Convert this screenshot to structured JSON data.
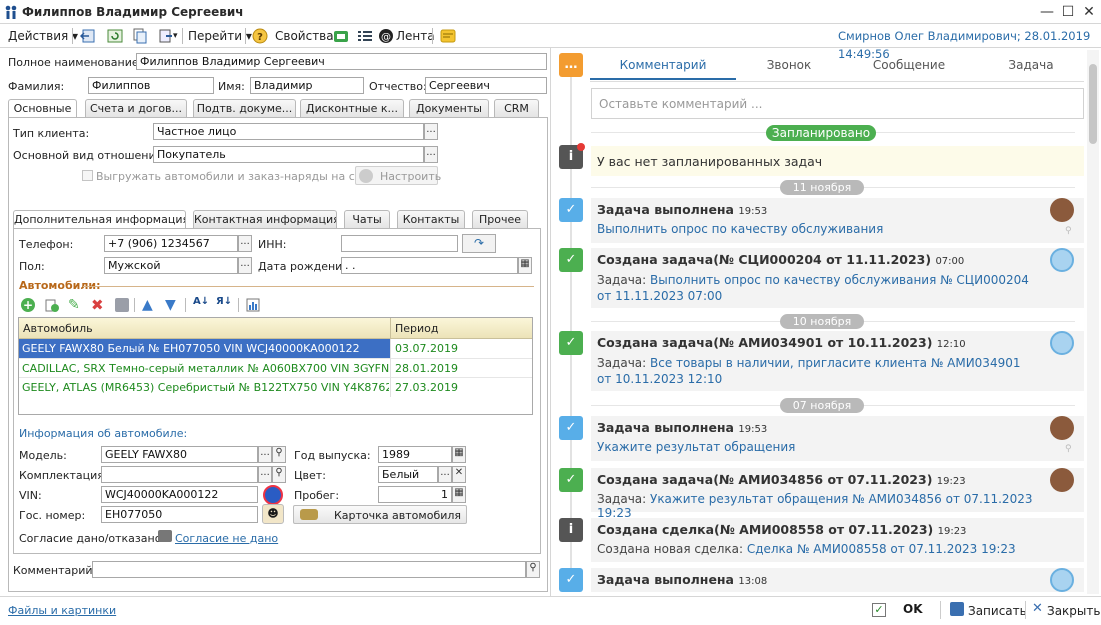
{
  "window": {
    "title": "Филиппов Владимир Сергеевич"
  },
  "toolbar": {
    "actions": "Действия",
    "goto": "Перейти",
    "properties": "Свойства",
    "feed": "Лента",
    "user_info": "Смирнов Олег Владимирович; 28.01.2019 14:49:56"
  },
  "form": {
    "fullname_label": "Полное наименование:",
    "fullname": "Филиппов Владимир Сергеевич",
    "lastname_label": "Фамилия:",
    "lastname": "Филиппов",
    "firstname_label": "Имя:",
    "firstname": "Владимир",
    "middlename_label": "Отчество:",
    "middlename": "Сергеевич"
  },
  "tabs": [
    "Основные",
    "Счета и догов...",
    "Подтв. докуме...",
    "Дисконтные к...",
    "Документы",
    "CRM"
  ],
  "basic": {
    "client_type_label": "Тип клиента:",
    "client_type": "Частное лицо",
    "relation_label": "Основной вид отношений:",
    "relation": "Покупатель",
    "export_label": "Выгружать автомобили и заказ-наряды на сайт",
    "setup": "Настроить"
  },
  "subtabs": [
    "Дополнительная информация",
    "Контактная информация",
    "Чаты",
    "Контакты",
    "Прочее"
  ],
  "info": {
    "phone_label": "Телефон:",
    "phone": "+7 (906) 1234567",
    "inn_label": "ИНН:",
    "inn": "",
    "gender_label": "Пол:",
    "gender": "Мужской",
    "birth_label": "Дата рождения:",
    "birth": " .  ."
  },
  "cars": {
    "title": "Автомобили:",
    "col_car": "Автомобиль",
    "col_period": "Период",
    "rows": [
      {
        "car": "GEELY FAWX80 Белый № ЕН077050 VIN WCJ40000KA000122",
        "period": "03.07.2019"
      },
      {
        "car": "CADILLAC, SRX Темно-серый металлик № А060ВХ700 VIN 3GYFN9E5...",
        "period": "28.01.2019"
      },
      {
        "car": "GEELY, ATLAS (MR6453) Серебристый № В122ТХ750 VIN Y4K8762D9J...",
        "period": "27.03.2019"
      }
    ]
  },
  "carinfo": {
    "title": "Информация об автомобиле:",
    "model_label": "Модель:",
    "model": "GEELY FAWX80",
    "complect_label": "Комплектация:",
    "complect": "",
    "vin_label": "VIN:",
    "vin": "WCJ40000KA000122",
    "plate_label": "Гос. номер:",
    "plate": "ЕН077050",
    "year_label": "Год выпуска:",
    "year": "1989",
    "color_label": "Цвет:",
    "color": "Белый",
    "mileage_label": "Пробег:",
    "mileage": "1",
    "card": "Карточка автомобиля"
  },
  "consent": {
    "label": "Согласие дано/отказано:",
    "link": "Согласие не дано"
  },
  "comment": {
    "label": "Комментарий:",
    "value": ""
  },
  "files": "Файлы и картинки",
  "bottom": {
    "ok": "OK",
    "save": "Записать",
    "close": "Закрыть"
  },
  "feed": {
    "tabs": [
      "Комментарий",
      "Звонок",
      "Сообщение",
      "Задача"
    ],
    "placeholder": "Оставьте комментарий ...",
    "planned": "Запланировано",
    "no_tasks": "У вас нет запланированных задач",
    "dates": [
      "11 ноября",
      "10 ноября",
      "07 ноября"
    ],
    "events": [
      {
        "title": "Задача выполнена",
        "time": "19:53",
        "body": "Выполнить опрос по качеству обслуживания"
      },
      {
        "title": "Создана задача(№ СЦИ000204 от 11.11.2023)",
        "time": "07:00",
        "prefix": "Задача: ",
        "body": "Выполнить опрос по качеству обслуживания № СЦИ000204 от 11.11.2023 07:00"
      },
      {
        "title": "Создана задача(№ АМИ034901 от 10.11.2023)",
        "time": "12:10",
        "prefix": "Задача: ",
        "body": "Все товары в наличии, пригласите клиента № АМИ034901 от 10.11.2023 12:10"
      },
      {
        "title": "Задача выполнена",
        "time": "19:53",
        "body": "Укажите результат обращения"
      },
      {
        "title": "Создана задача(№ АМИ034856 от 07.11.2023)",
        "time": "19:23",
        "prefix": "Задача: ",
        "body": "Укажите результат обращения № АМИ034856 от 07.11.2023 19:23"
      },
      {
        "title": "Создана сделка(№ АМИ008558 от 07.11.2023)",
        "time": "19:23",
        "prefix": "Создана новая сделка: ",
        "body": "Сделка № АМИ008558 от 07.11.2023 19:23"
      },
      {
        "title": "Задача выполнена",
        "time": "13:08",
        "body": ""
      }
    ]
  },
  "colors": {
    "accent": "#2a6ca8",
    "green": "#4caf50",
    "orange": "#f39c30",
    "selected_row": "#3c6fc4",
    "task_done": "#58aee8"
  }
}
